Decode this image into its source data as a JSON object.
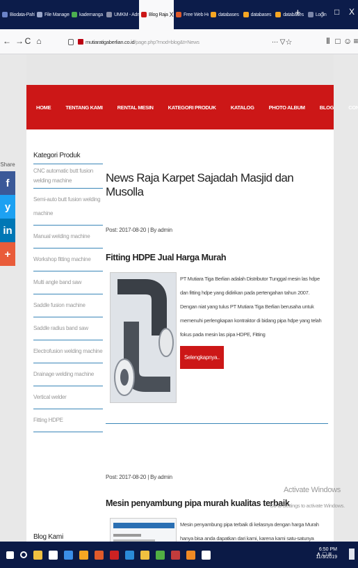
{
  "tabs": [
    {
      "label": "Biodata-Pahl",
      "color": "#6b83c9"
    },
    {
      "label": "File Manager",
      "color": "#9aa6c9"
    },
    {
      "label": "kadernanga",
      "color": "#4caf50"
    },
    {
      "label": "UMKM - Admin",
      "color": "#8a8fa8"
    },
    {
      "label": "Blog Raja",
      "color": "#cc1717",
      "active": true
    },
    {
      "label": "Free Web Ho",
      "color": "#e05a2a"
    },
    {
      "label": "databases",
      "color": "#f6a623"
    },
    {
      "label": "databases",
      "color": "#f6a623"
    },
    {
      "label": "databases",
      "color": "#f6a623"
    },
    {
      "label": "Login",
      "color": "#7b86a8"
    }
  ],
  "window": {
    "plus": "+",
    "minimize": "-",
    "restore": "□",
    "close": "X",
    "tab_close": "X"
  },
  "nav": {
    "back": "←",
    "forward": "→",
    "reload": "C",
    "home": "⌂"
  },
  "url": {
    "domain": "mutiaratigaberlian.co.id",
    "path": "/page.php?mod=blog&t=News",
    "more": "···",
    "pocket": "▽",
    "star": "☆"
  },
  "toolbar_right": [
    "Ⅱ",
    "□",
    "☺",
    "≡"
  ],
  "menu": [
    "HOME",
    "TENTANG KAMI",
    "RENTAL MESIN",
    "KATEGORI PRODUK",
    "KATALOG",
    "PHOTO ALBUM",
    "BLOG",
    "CONTACTS"
  ],
  "share": {
    "label": "Share",
    "buttons": [
      {
        "glyph": "f",
        "color": "#3b5998"
      },
      {
        "glyph": "y",
        "color": "#1da1f2"
      },
      {
        "glyph": "in",
        "color": "#0077b5"
      },
      {
        "glyph": "+",
        "color": "#e95c3a"
      }
    ]
  },
  "sidebar": {
    "title": "Kategori Produk",
    "items": [
      "CNC automatic butt fusion welding machine",
      "Semi-auto butt fusion welding machine",
      "Manual welding machine",
      "Workshop fitting machine",
      "Multi angle band saw",
      "Saddle fusion machine",
      "Saddle radius band saw",
      "Electrofusion welding machine",
      "Drainage welding machine",
      "Vertical welder",
      "Fitting HDPE"
    ],
    "second_title": "Blog Kami"
  },
  "page_title": "News Raja Karpet Sajadah Masjid dan Musolla",
  "posts": [
    {
      "meta": "Post: 2017-08-20  |  By admin",
      "title": "Fitting HDPE Jual Harga Murah",
      "excerpt": "PT Mutiara Tiga Berlian adalah Distributor Tunggal mesin las hdpe dan fitting hdpe yang didirikan pada pertengahan tahun 2007. Dengan niat yang tulus PT Mutiara Tiga Berlian berusaha untuk memenuhi perlengkapan kontraktor di bidang pipa hdpe yang telah fokus pada mesin las pipa HDPE, Fitting",
      "button": "Selengkapnya.."
    },
    {
      "meta": "Post: 2017-08-20  |  By admin",
      "title": "Mesin penyambung pipa murah kualitas terbaik",
      "excerpt": "Mesin penyambung pipa terbaik di kelasnya dengan harga Murah hanya bisa anda dapatkan dari kami, karena kami satu-satunya Distributor tunggal Wuxi Shengda di"
    }
  ],
  "watermark": {
    "title": "Activate Windows",
    "sub": "Go to Settings to activate Windows."
  },
  "taskbar": {
    "icons": [
      "#ffffff",
      "#ffffff",
      "#f0c040",
      "#ffffff",
      "#3b8ee8",
      "#f6a623",
      "#e05a2a",
      "#cc2222",
      "#2a8ad8",
      "#f0c040",
      "#52b043",
      "#c23c3c",
      "#f08a24",
      "#ffffff"
    ],
    "time": "6:50 PM",
    "date": "11/3/2019",
    "tray": "∧ □ ≡"
  }
}
